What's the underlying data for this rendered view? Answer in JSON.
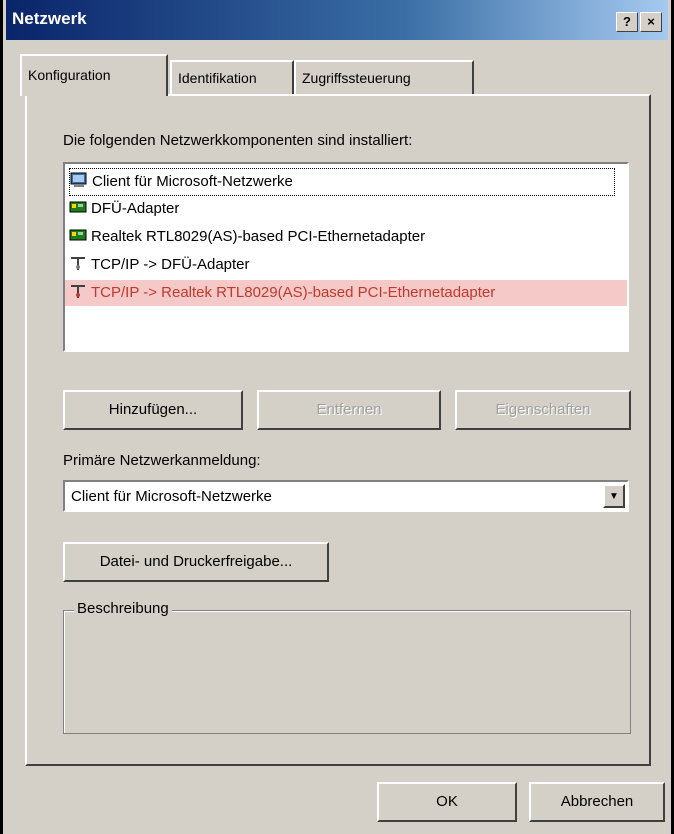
{
  "window": {
    "title": "Netzwerk",
    "help_glyph": "?",
    "close_glyph": "×"
  },
  "tabs": [
    {
      "label": "Konfiguration",
      "active": true
    },
    {
      "label": "Identifikation",
      "active": false
    },
    {
      "label": "Zugriffssteuerung",
      "active": false
    }
  ],
  "components": {
    "heading": "Die folgenden Netzwerkkomponenten sind installiert:",
    "items": [
      {
        "label": "Client für Microsoft-Netzwerke",
        "icon": "network-client-icon"
      },
      {
        "label": "DFÜ-Adapter",
        "icon": "network-adapter-icon"
      },
      {
        "label": "Realtek RTL8029(AS)-based PCI-Ethernetadapter",
        "icon": "network-adapter-icon"
      },
      {
        "label": "TCP/IP -> DFÜ-Adapter",
        "icon": "protocol-icon"
      },
      {
        "label": "TCP/IP -> Realtek RTL8029(AS)-based PCI-Ethernetadapter",
        "icon": "protocol-icon",
        "selected": true
      }
    ]
  },
  "buttons": {
    "add": "Hinzufügen...",
    "remove": "Entfernen",
    "properties": "Eigenschaften"
  },
  "primary_logon": {
    "label": "Primäre Netzwerkanmeldung:",
    "value": "Client für Microsoft-Netzwerke"
  },
  "file_print": {
    "label": "Datei- und Druckerfreigabe..."
  },
  "description": {
    "title": "Beschreibung"
  },
  "footer": {
    "ok": "OK",
    "cancel": "Abbrechen"
  },
  "colors": {
    "titlebar_start": "#0a246a",
    "selection_bg": "#f6c9c9",
    "selection_text": "#c0392b"
  }
}
